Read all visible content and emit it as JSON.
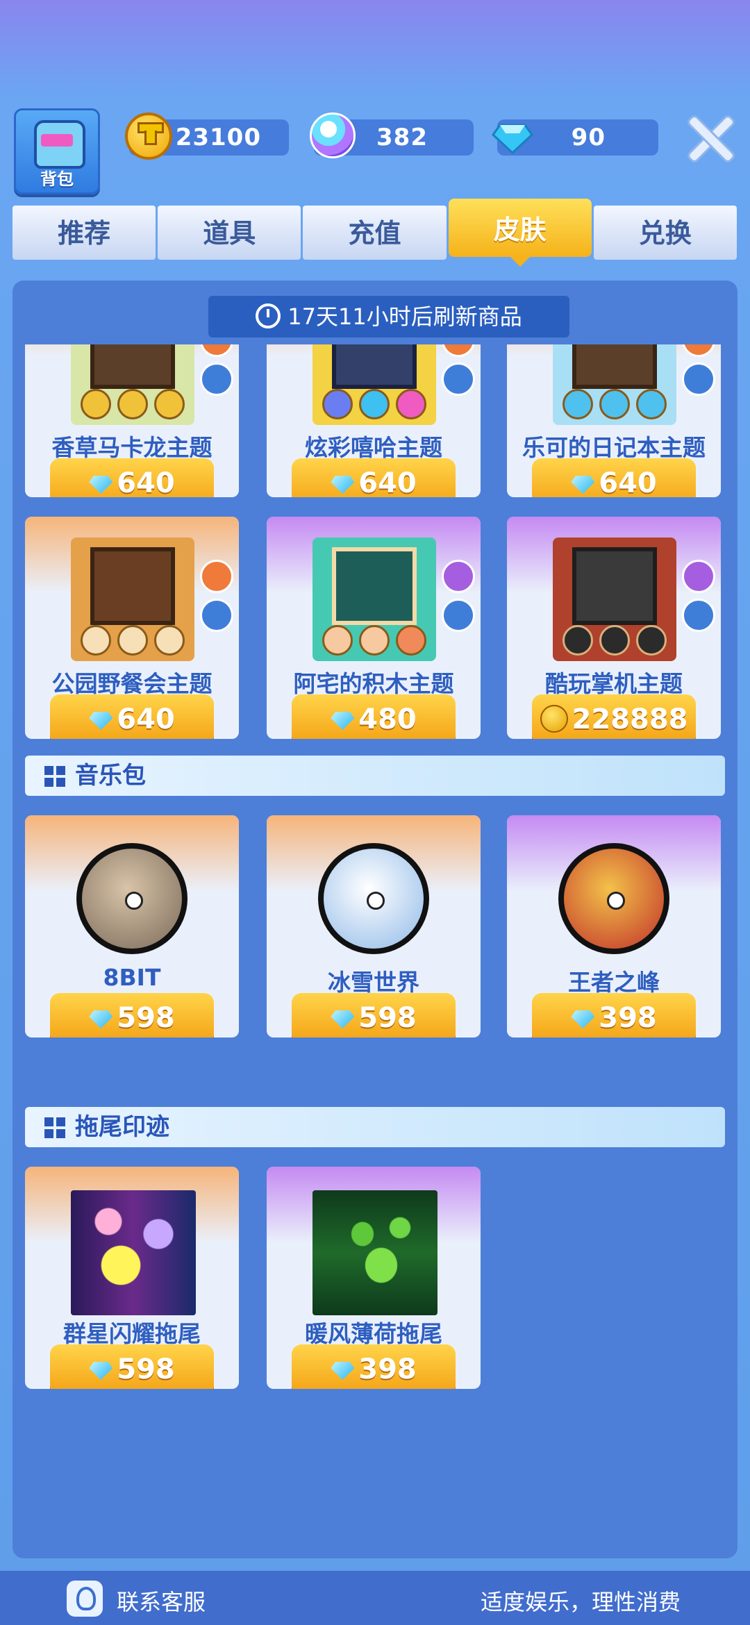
{
  "header": {
    "bag_label": "背包",
    "gold": "23100",
    "orbs": "382",
    "diamonds": "90"
  },
  "tabs": [
    {
      "label": "推荐"
    },
    {
      "label": "道具"
    },
    {
      "label": "充值"
    },
    {
      "label": "皮肤",
      "active": true
    },
    {
      "label": "兑换"
    }
  ],
  "refresh_text": "17天11小时后刷新商品",
  "themes": [
    {
      "name": "香草马卡龙主题",
      "price": "640",
      "currency": "diamond-icon"
    },
    {
      "name": "炫彩嘻哈主题",
      "price": "640",
      "currency": "diamond-icon"
    },
    {
      "name": "乐可的日记本主题",
      "price": "640",
      "currency": "diamond-icon"
    },
    {
      "name": "公园野餐会主题",
      "price": "640",
      "currency": "diamond-icon"
    },
    {
      "name": "阿宅的积木主题",
      "price": "480",
      "currency": "diamond-icon"
    },
    {
      "name": "酷玩掌机主题",
      "price": "228888",
      "currency": "gold-coin-icon"
    }
  ],
  "music_section": {
    "title": "音乐包",
    "items": [
      {
        "name": "8BIT",
        "price": "598"
      },
      {
        "name": "冰雪世界",
        "price": "598"
      },
      {
        "name": "王者之峰",
        "price": "398"
      }
    ]
  },
  "trail_section": {
    "title": "拖尾印迹",
    "items": [
      {
        "name": "群星闪耀拖尾",
        "price": "598"
      },
      {
        "name": "暖风薄荷拖尾",
        "price": "398"
      }
    ]
  },
  "footer": {
    "customer_service": "联系客服",
    "slogan": "适度娱乐，理性消费"
  },
  "colors": {
    "accent_yellow": "#f5b21a",
    "primary_blue": "#2e5ec0",
    "panel_blue": "#4d7fd8"
  }
}
